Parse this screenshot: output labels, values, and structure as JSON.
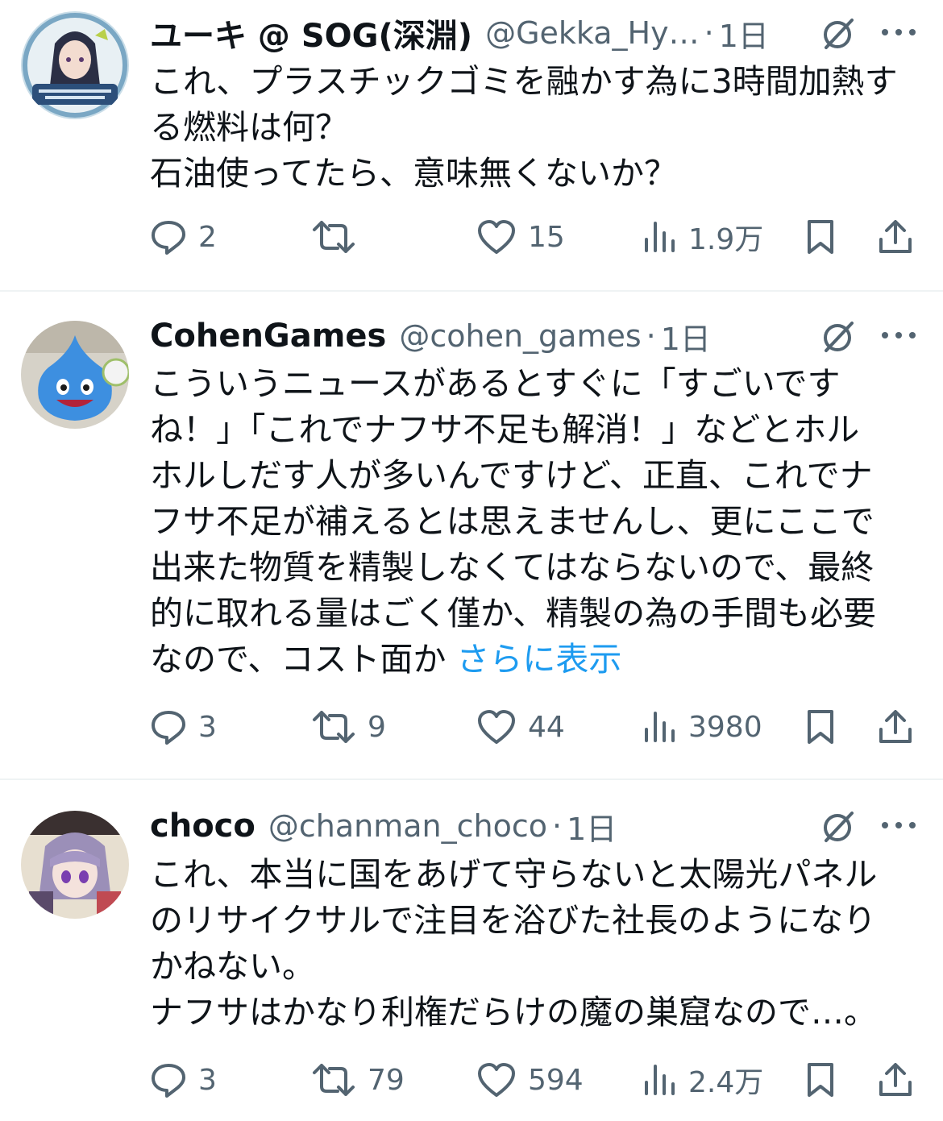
{
  "colors": {
    "text": "#0f1419",
    "muted": "#536471",
    "link": "#1d9bf0",
    "divider": "#eff3f4"
  },
  "tweets": [
    {
      "display_name": "ユーキ @ SOG(深淵)",
      "handle": "@Gekka_Hy…",
      "separator": "·",
      "time": "1日",
      "body_lines": [
        "これ、プラスチックゴミを融かす為に3時間加熱す",
        "る燃料は何？",
        "石油使ってたら、意味無くないか？"
      ],
      "show_more": "",
      "replies": "2",
      "reposts": "",
      "likes": "15",
      "views": "1.9万"
    },
    {
      "display_name": "CohenGames",
      "handle": "@cohen_games",
      "separator": "·",
      "time": "1日",
      "body_lines": [
        "こういうニュースがあるとすぐに「すごいです",
        "ね！」「これでナフサ不足も解消！」などとホル",
        "ホルしだす人が多いんですけど、正直、これでナ",
        "フサ不足が補えるとは思えませんし、更にここで",
        "出来た物質を精製しなくてはならないので、最終",
        "的に取れる量はごく僅か、精製の為の手間も必要",
        "なので、コスト面か"
      ],
      "show_more": "さらに表示",
      "replies": "3",
      "reposts": "9",
      "likes": "44",
      "views": "3980"
    },
    {
      "display_name": "choco",
      "handle": "@chanman_choco",
      "separator": "·",
      "time": "1日",
      "body_lines": [
        "これ、本当に国をあげて守らないと太陽光パネル",
        "のリサイクサルで注目を浴びた社長のようになり",
        "かねない。",
        "ナフサはかなり利権だらけの魔の巣窟なので…。"
      ],
      "show_more": "",
      "replies": "3",
      "reposts": "79",
      "likes": "594",
      "views": "2.4万"
    }
  ],
  "icons": [
    "grok-icon",
    "more-icon",
    "reply-icon",
    "repost-icon",
    "like-icon",
    "views-icon",
    "bookmark-icon",
    "share-icon"
  ]
}
